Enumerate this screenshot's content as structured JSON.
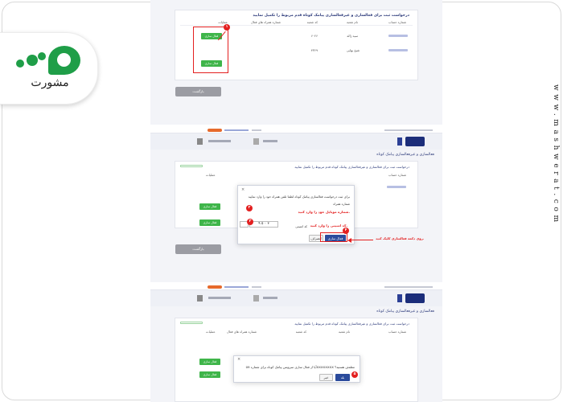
{
  "logo": {
    "wordmark": "مشورت"
  },
  "site_url": "www.mashwerat.com",
  "colors": {
    "accent_green": "#3fb54a",
    "brand_navy": "#1b2d7a",
    "annotation_red": "#e32020",
    "logo_green": "#1f9e48"
  },
  "page_title": "درخواست ثبت برای فعالسازی و غیرفعالسازی پیامک کوتاه قدم مربوط را تکمیل نمایید",
  "page_title_short": "فعالسازی و غیرفعالسازی پیامک کوتاه",
  "table": {
    "headers": [
      "شماره حساب",
      "نام شعبه",
      "کد شعبه",
      "شماره همراه های فعال",
      "عملیات"
    ],
    "rows": [
      {
        "account": "XXXXXXXX",
        "branch_name": "سید ژاله",
        "branch_code": "۶۰۲۶",
        "action_label": "فعال سازی"
      },
      {
        "account": "XXXXXXXX",
        "branch_name": "شیخ بهایی",
        "branch_code": "۴۳۶۹",
        "action_label": "فعال سازی"
      }
    ]
  },
  "return_button": "بازگشت",
  "modal1": {
    "title": "برای ثبت درخواست فعالسازی پیامک کوتاه لطفا تلفن همراه خود را وارد نمایید",
    "label_mobile": "شماره همراه",
    "label_code": "کد امنیتی",
    "captcha": "۹ ۵ ۰ ۳",
    "confirm": "فعال سازی",
    "cancel": "انصراف"
  },
  "modal2": {
    "question": "آیا از فعال سازی سرویس پیامک کوتاه برای شماره 09XXXXXXXX مطمئن هستید؟",
    "yes": "بله",
    "no": "خیر"
  },
  "annotations": {
    "step1": "شماره موبایل خود را وارد کنید.",
    "step2": "کد امنیتی را وارد کنید.",
    "step3": "روی دکمه فعالسازی کلیک کنید.",
    "num1": "۱",
    "num2": "۲",
    "num3": "۳",
    "num4": "۴",
    "num5": "۵"
  }
}
